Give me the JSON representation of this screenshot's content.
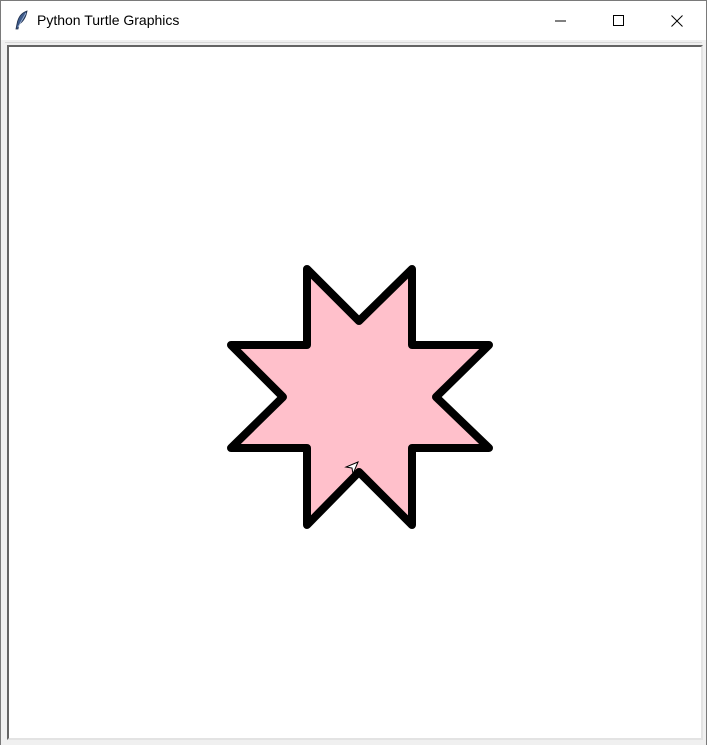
{
  "window": {
    "title": "Python Turtle Graphics",
    "icon": "feather-icon",
    "controls": {
      "minimize": "minimize-icon",
      "maximize": "maximize-icon",
      "close": "close-icon"
    }
  },
  "drawing": {
    "shape": "eight-pointed-star",
    "fill_color": "#ffc0cb",
    "pen_color": "#000000",
    "turtle_cursor": "turtle-arrow-icon"
  }
}
